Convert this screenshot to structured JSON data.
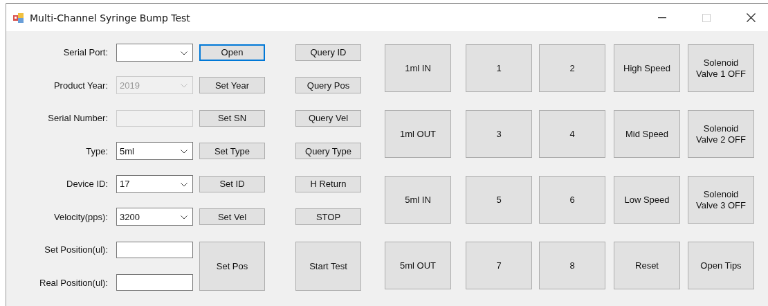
{
  "window": {
    "title": "Multi-Channel Syringe Bump Test"
  },
  "form_rows": [
    {
      "label": "Serial Port:",
      "field": {
        "kind": "combo",
        "disabled": false
      },
      "action": {
        "label": "Open",
        "focused": true
      },
      "query": {
        "label": "Query ID"
      }
    },
    {
      "label": "Product Year:",
      "field": {
        "kind": "combo",
        "value": "2019",
        "disabled": true
      },
      "action": {
        "label": "Set Year",
        "focused": false
      },
      "query": {
        "label": "Query Pos"
      }
    },
    {
      "label": "Serial Number:",
      "field": {
        "kind": "text",
        "disabled": true
      },
      "action": {
        "label": "Set SN",
        "focused": false
      },
      "query": {
        "label": "Query Vel"
      }
    },
    {
      "label": "Type:",
      "field": {
        "kind": "combo",
        "value": "5ml",
        "disabled": false
      },
      "action": {
        "label": "Set Type",
        "focused": false
      },
      "query": {
        "label": "Query Type"
      }
    },
    {
      "label": "Device ID:",
      "field": {
        "kind": "combo",
        "value": "17",
        "disabled": false
      },
      "action": {
        "label": "Set ID",
        "focused": false
      },
      "query": {
        "label": "H Return"
      }
    },
    {
      "label": "Velocity(pps):",
      "field": {
        "kind": "combo",
        "value": "3200",
        "disabled": false
      },
      "action": {
        "label": "Set Vel",
        "focused": false
      },
      "query": {
        "label": "STOP"
      }
    }
  ],
  "position_fields": [
    {
      "label": "Set Position(ul):",
      "field": {
        "kind": "text",
        "disabled": false
      }
    },
    {
      "label": "Real Position(ul):",
      "field": {
        "kind": "text",
        "disabled": false
      }
    }
  ],
  "set_pos_button": {
    "label": "Set Pos"
  },
  "start_test_button": {
    "label": "Start Test"
  },
  "grid_buttons": [
    [
      "1ml IN",
      "1",
      "2",
      "High Speed",
      "Solenoid Valve 1 OFF"
    ],
    [
      "1ml OUT",
      "3",
      "4",
      "Mid Speed",
      "Solenoid Valve 2 OFF"
    ],
    [
      "5ml IN",
      "5",
      "6",
      "Low Speed",
      "Solenoid Valve 3 OFF"
    ],
    [
      "5ml OUT",
      "7",
      "8",
      "Reset",
      "Open Tips"
    ]
  ]
}
